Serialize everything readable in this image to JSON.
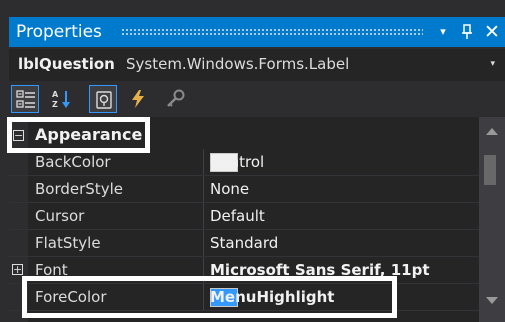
{
  "window": {
    "title": "Properties",
    "pin_glyph": "Ă",
    "close_glyph": "✕",
    "dropdown_glyph": "▾"
  },
  "object": {
    "name": "lblQuestion",
    "type": "System.Windows.Forms.Label",
    "dropdown_glyph": "▾"
  },
  "toolbar": {
    "buttons": [
      {
        "icon": "categorized-icon",
        "active": true
      },
      {
        "icon": "alphabetical-icon",
        "active": false
      },
      {
        "icon": "properties-icon",
        "active": true
      },
      {
        "icon": "events-icon",
        "active": false
      },
      {
        "icon": "property-pages-icon",
        "active": false
      }
    ]
  },
  "grid": {
    "category": {
      "label": "Appearance",
      "expander": "−"
    },
    "rows": [
      {
        "name": "BackColor",
        "value": "Control",
        "swatch": "#f0f0f0"
      },
      {
        "name": "BorderStyle",
        "value": "None"
      },
      {
        "name": "Cursor",
        "value": "Default"
      },
      {
        "name": "FlatStyle",
        "value": "Standard"
      },
      {
        "name": "Font",
        "value": "Microsoft Sans Serif, 11pt",
        "bold": true,
        "expander": "+"
      },
      {
        "name": "ForeColor",
        "value": "MenuHighlight",
        "swatch": "#3399ff",
        "bold": true
      }
    ]
  },
  "colors": {
    "accent": "#007acc",
    "background": "#2d2d30",
    "grid_background": "#252526",
    "highlight_box": "#ffffff"
  }
}
